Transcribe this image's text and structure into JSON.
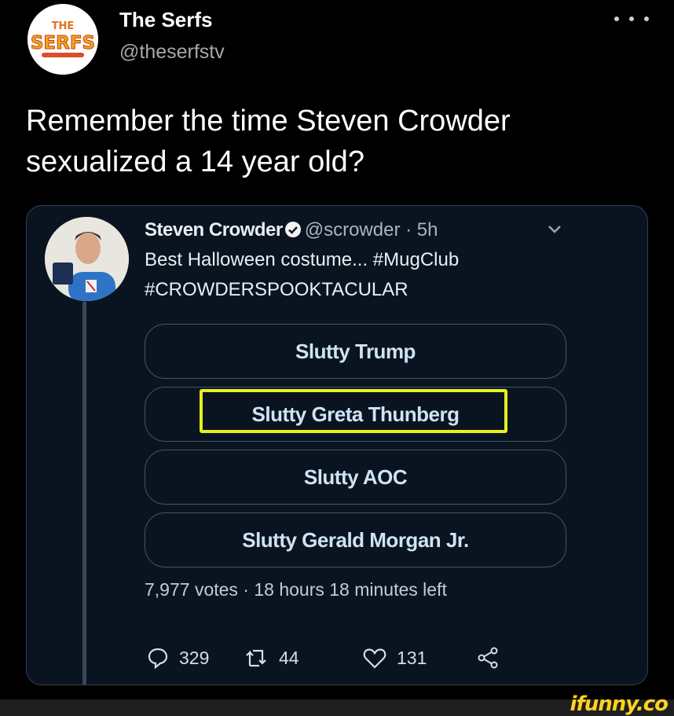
{
  "author": {
    "name": "The Serfs",
    "handle": "@theserfstv",
    "avatar_logo_text": [
      "THE",
      "SERFS"
    ]
  },
  "tweet": {
    "text_line1": "Remember the time Steven Crowder",
    "text_line2": "sexualized a 14 year old?"
  },
  "embedded": {
    "name": "Steven Crowder",
    "handle": "@scrowder",
    "separator": "·",
    "time": "5h",
    "body_line1": "Best Halloween costume... #MugClub",
    "body_line2": "#CROWDERSPOOKTACULAR",
    "poll": {
      "options": [
        "Slutty Trump",
        "Slutty Greta Thunberg",
        "Slutty AOC",
        "Slutty Gerald Morgan Jr."
      ],
      "highlighted_option": "Slutty Greta Thunberg",
      "summary": "7,977 votes · 18 hours 18 minutes left"
    },
    "actions": {
      "replies": "329",
      "retweets": "44",
      "likes": "131"
    }
  },
  "watermark": "ifunny.co",
  "colors": {
    "background": "#000000",
    "card_background": "#0a1420",
    "highlight": "#e6f01e",
    "watermark": "#ffd21f"
  }
}
